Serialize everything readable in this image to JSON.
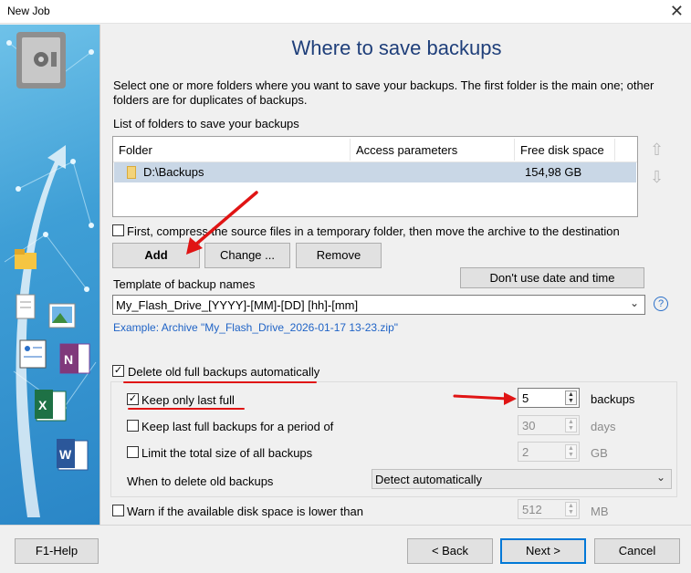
{
  "window": {
    "title": "New Job",
    "close_glyph": "✕"
  },
  "page_title": "Where to save backups",
  "description": "Select one or more folders where you want to save your backups. The first folder is the main one; other folders are for duplicates of backups.",
  "list_label": "List of folders to save your backups",
  "folders": {
    "columns": [
      "Folder",
      "Access parameters",
      "Free disk space"
    ],
    "rows": [
      {
        "folder": "D:\\Backups",
        "access": "",
        "free": "154,98 GB"
      }
    ]
  },
  "move_up_icon": "⇧",
  "move_down_icon": "⇩",
  "compress_checkbox": {
    "label": "First, compress the source files in a temporary folder, then move the archive to the destination",
    "checked": false
  },
  "buttons": {
    "add": "Add",
    "change": "Change ...",
    "remove": "Remove",
    "no_date": "Don't use date and time",
    "help": "F1-Help",
    "back": "< Back",
    "next": "Next >",
    "cancel": "Cancel"
  },
  "template_label": "Template of backup names",
  "template_value": "My_Flash_Drive_[YYYY]-[MM]-[DD] [hh]-[mm]",
  "help_glyph": "?",
  "example_text": "Example: Archive \"My_Flash_Drive_2026-01-17 13-23.zip\"",
  "delete_old": {
    "label": "Delete old full backups automatically",
    "checked": true
  },
  "keep_last": {
    "label": "Keep only last full",
    "checked": true,
    "value": "5",
    "unit": "backups"
  },
  "keep_period": {
    "label": "Keep last full backups for a period of",
    "checked": false,
    "value": "30",
    "unit": "days"
  },
  "limit_size": {
    "label": "Limit the total size of all backups",
    "checked": false,
    "value": "2",
    "unit": "GB"
  },
  "when_delete": {
    "label": "When to delete old backups",
    "value": "Detect automatically"
  },
  "warn_space": {
    "label": "Warn if the available disk space is lower than",
    "checked": false,
    "value": "512",
    "unit": "MB"
  },
  "check_glyph": "✓",
  "spin_glyphs": {
    "up": "▲",
    "down": "▼"
  },
  "dropdown_glyph": "⌄",
  "colors": {
    "accent": "#0078d7",
    "title": "#1f3f7a",
    "annotation": "#e01414",
    "link": "#1f63c6"
  }
}
